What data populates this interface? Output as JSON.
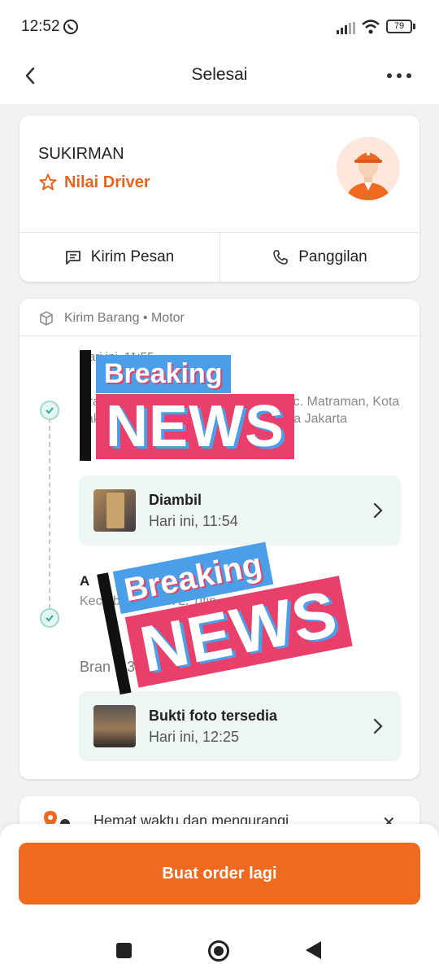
{
  "status_bar": {
    "time": "12:52",
    "battery": "79"
  },
  "app_bar": {
    "title": "Selesai"
  },
  "driver": {
    "name": "SUKIRMAN",
    "rate_label": "Nilai Driver",
    "actions": {
      "message": "Kirim Pesan",
      "call": "Panggilan"
    }
  },
  "order": {
    "service": "Kirim Barang • Motor",
    "pickup": {
      "time": "Hari ini, 11:55",
      "address": "Pramuka, RT.1/RW.6, Palmeriam, Kec. Matraman, Kota Jakarta Timur, Daerah Khusus Ibukota Jakarta"
    },
    "pickup_stage": {
      "title": "Diambil",
      "time": "Hari ini, 11:54"
    },
    "dropoff": {
      "title": "A",
      "address": "Kec. Ibu. ...21/27L. Titip",
      "contact": "Bran ...368"
    },
    "dropoff_stage": {
      "title": "Bukti foto tersedia",
      "time": "Hari ini, 12:25"
    }
  },
  "stickers": [
    {
      "top_text": "Breaking",
      "bottom_text": "NEWS"
    },
    {
      "top_text": "Breaking",
      "bottom_text": "NEWS"
    }
  ],
  "promo": {
    "text": "Hemat waktu dan mengurangi"
  },
  "bottom": {
    "reorder_label": "Buat order lagi"
  },
  "colors": {
    "accent": "#ee6a21",
    "success": "#2fb08f",
    "sticker_blue": "#4a9fe8",
    "sticker_pink": "#e8406a"
  }
}
